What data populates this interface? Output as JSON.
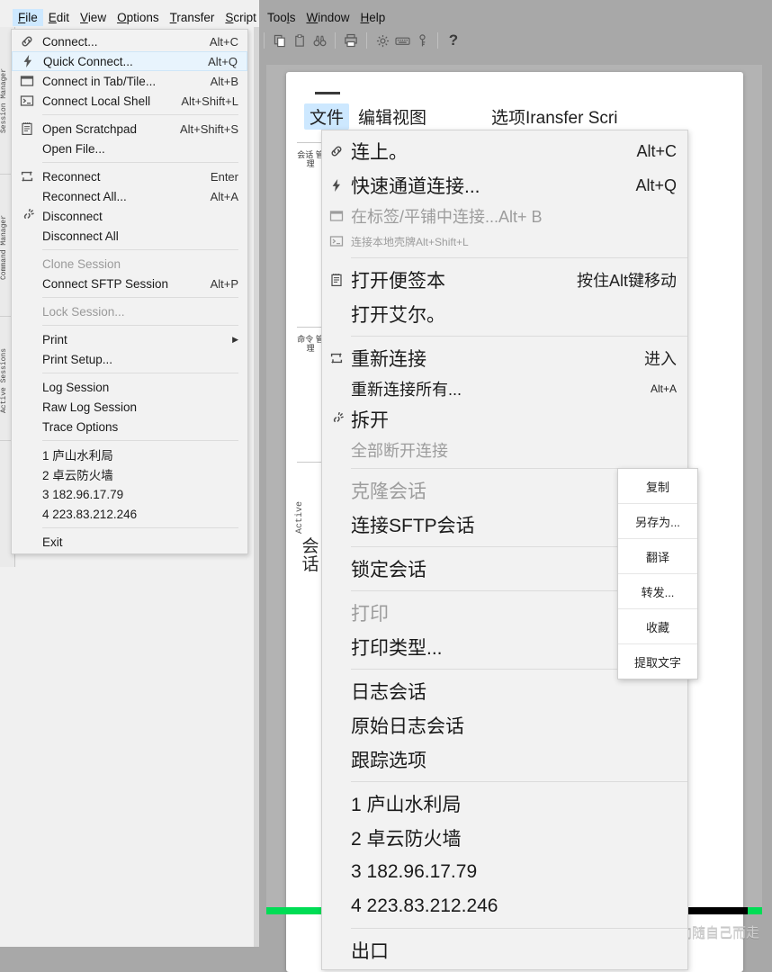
{
  "app": {
    "menubar": [
      {
        "label": "File",
        "mnemonic": "F",
        "active": true
      },
      {
        "label": "Edit",
        "mnemonic": "E",
        "active": false
      },
      {
        "label": "View",
        "mnemonic": "V",
        "active": false
      },
      {
        "label": "Options",
        "mnemonic": "O",
        "active": false
      },
      {
        "label": "Transfer",
        "mnemonic": "T",
        "active": false
      },
      {
        "label": "Script",
        "mnemonic": "S",
        "active": false
      },
      {
        "label": "Tools",
        "mnemonic": "l",
        "active": false
      },
      {
        "label": "Window",
        "mnemonic": "W",
        "active": false
      },
      {
        "label": "Help",
        "mnemonic": "H",
        "active": false
      }
    ],
    "toolbar_icons": [
      "copy-icon",
      "paste-icon",
      "find-icon",
      "print-icon",
      "settings-gear-icon",
      "keyboard-icon",
      "key-icon",
      "help-question-icon"
    ],
    "side_tabs": [
      {
        "label": "Session Manager"
      },
      {
        "label": "Command Manager"
      },
      {
        "label": "Active Sessions"
      }
    ]
  },
  "file_menu": {
    "items": [
      {
        "label": "Connect...",
        "accel": "Alt+C",
        "icon": "link-icon",
        "state": "normal",
        "type": "item"
      },
      {
        "label": "Quick Connect...",
        "accel": "Alt+Q",
        "icon": "lightning-icon",
        "state": "highlighted",
        "type": "item"
      },
      {
        "label": "Connect in Tab/Tile...",
        "accel": "Alt+B",
        "icon": "window-icon",
        "state": "normal",
        "type": "item"
      },
      {
        "label": "Connect Local Shell",
        "accel": "Alt+Shift+L",
        "icon": "terminal-icon",
        "state": "normal",
        "type": "item"
      },
      {
        "type": "separator"
      },
      {
        "label": "Open Scratchpad",
        "accel": "Alt+Shift+S",
        "icon": "notepad-icon",
        "state": "normal",
        "type": "item"
      },
      {
        "label": "Open File...",
        "accel": "",
        "icon": "",
        "state": "normal",
        "type": "item"
      },
      {
        "type": "separator"
      },
      {
        "label": "Reconnect",
        "accel": "Enter",
        "icon": "reconnect-icon",
        "state": "normal",
        "type": "item"
      },
      {
        "label": "Reconnect All...",
        "accel": "Alt+A",
        "icon": "",
        "state": "normal",
        "type": "item"
      },
      {
        "label": "Disconnect",
        "accel": "",
        "icon": "disconnect-icon",
        "state": "normal",
        "type": "item"
      },
      {
        "label": "Disconnect All",
        "accel": "",
        "icon": "",
        "state": "normal",
        "type": "item"
      },
      {
        "type": "separator"
      },
      {
        "label": "Clone Session",
        "accel": "",
        "icon": "",
        "state": "disabled",
        "type": "item"
      },
      {
        "label": "Connect SFTP Session",
        "accel": "Alt+P",
        "icon": "",
        "state": "normal",
        "type": "item"
      },
      {
        "type": "separator"
      },
      {
        "label": "Lock Session...",
        "accel": "",
        "icon": "",
        "state": "disabled",
        "type": "item"
      },
      {
        "type": "separator"
      },
      {
        "label": "Print",
        "accel": "",
        "icon": "",
        "state": "submenu",
        "type": "item"
      },
      {
        "label": "Print Setup...",
        "accel": "",
        "icon": "",
        "state": "normal",
        "type": "item"
      },
      {
        "type": "separator"
      },
      {
        "label": "Log Session",
        "accel": "",
        "icon": "",
        "state": "normal",
        "type": "item"
      },
      {
        "label": "Raw Log Session",
        "accel": "",
        "icon": "",
        "state": "normal",
        "type": "item"
      },
      {
        "label": "Trace Options",
        "accel": "",
        "icon": "",
        "state": "normal",
        "type": "item"
      },
      {
        "type": "separator"
      },
      {
        "label": "1 庐山水利局",
        "accel": "",
        "icon": "",
        "state": "normal",
        "type": "item"
      },
      {
        "label": "2 卓云防火墙",
        "accel": "",
        "icon": "",
        "state": "normal",
        "type": "item"
      },
      {
        "label": "3 182.96.17.79",
        "accel": "",
        "icon": "",
        "state": "normal",
        "type": "item"
      },
      {
        "label": "4 223.83.212.246",
        "accel": "",
        "icon": "",
        "state": "normal",
        "type": "item"
      },
      {
        "type": "separator"
      },
      {
        "label": "Exit",
        "accel": "",
        "icon": "",
        "state": "normal",
        "type": "item"
      }
    ]
  },
  "inner_screenshot": {
    "menubar": [
      {
        "label": "文件",
        "active": true
      },
      {
        "label": "编辑视图",
        "active": false
      },
      {
        "label": "选项Iransfer Scri",
        "active": false
      }
    ],
    "side_tabs": [
      {
        "label": "会话\n管理"
      },
      {
        "label": "命令\n管理"
      },
      {
        "label": "Active"
      },
      {
        "label": "会话"
      }
    ],
    "menu_items": [
      {
        "label": "连上。",
        "accel": "Alt+C",
        "icon": "link-icon",
        "size": "lg",
        "state": "normal",
        "type": "item"
      },
      {
        "label": "快速通道连接...",
        "accel": "Alt+Q",
        "icon": "lightning-icon",
        "size": "lg",
        "state": "normal",
        "type": "item"
      },
      {
        "label": "在标签/平铺中连接...Alt+ B",
        "accel": "",
        "icon": "window-icon",
        "size": "md",
        "state": "dim",
        "type": "item"
      },
      {
        "label": "连接本地壳牌Alt+Shift+L",
        "accel": "",
        "icon": "terminal-icon",
        "size": "sm",
        "state": "dim",
        "type": "item"
      },
      {
        "type": "separator"
      },
      {
        "label": "打开便签本",
        "accel": "按住Alt键移动",
        "icon": "notepad-icon",
        "size": "lg",
        "state": "normal",
        "type": "item"
      },
      {
        "label": "打开艾尔。",
        "accel": "",
        "icon": "",
        "size": "lg",
        "state": "normal",
        "type": "item"
      },
      {
        "type": "separator"
      },
      {
        "label": "重新连接",
        "accel": "进入",
        "icon": "reconnect-icon",
        "size": "lg",
        "state": "normal",
        "type": "item"
      },
      {
        "label": "重新连接所有...",
        "accel": "Alt+A",
        "icon": "",
        "size": "md",
        "state": "normal",
        "type": "item"
      },
      {
        "label": "拆开",
        "accel": "",
        "icon": "disconnect-icon",
        "size": "lg",
        "state": "normal",
        "type": "item"
      },
      {
        "label": "全部断开连接",
        "accel": "",
        "icon": "",
        "size": "md",
        "state": "dim",
        "type": "item"
      },
      {
        "type": "separator"
      },
      {
        "label": "克隆会话",
        "accel": "",
        "icon": "",
        "size": "lg",
        "state": "dim",
        "type": "item"
      },
      {
        "label": "连接SFTP会话",
        "accel": "",
        "icon": "",
        "size": "lg",
        "state": "normal",
        "type": "item"
      },
      {
        "type": "separator"
      },
      {
        "label": "锁定会话",
        "accel": "",
        "icon": "",
        "size": "lg",
        "state": "normal",
        "type": "item"
      },
      {
        "type": "separator"
      },
      {
        "label": "打印",
        "accel": "",
        "icon": "",
        "size": "lg",
        "state": "dim",
        "type": "item"
      },
      {
        "label": "打印类型...",
        "accel": "",
        "icon": "",
        "size": "lg",
        "state": "normal",
        "type": "item"
      },
      {
        "type": "separator"
      },
      {
        "label": "日志会话",
        "accel": "",
        "icon": "",
        "size": "lg",
        "state": "normal",
        "type": "item"
      },
      {
        "label": "原始日志会话",
        "accel": "",
        "icon": "",
        "size": "lg",
        "state": "normal",
        "type": "item"
      },
      {
        "label": "跟踪选项",
        "accel": "",
        "icon": "",
        "size": "lg",
        "state": "normal",
        "type": "item"
      },
      {
        "type": "separator"
      },
      {
        "label": "1 庐山水利局",
        "accel": "",
        "icon": "",
        "size": "lg",
        "state": "normal",
        "type": "item"
      },
      {
        "label": "2 卓云防火墙",
        "accel": "",
        "icon": "",
        "size": "lg",
        "state": "normal",
        "type": "item"
      },
      {
        "label": "3 182.96.17.79",
        "accel": "",
        "icon": "",
        "size": "lg",
        "state": "normal",
        "type": "item"
      },
      {
        "label": "4 223.83.212.246",
        "accel": "",
        "icon": "",
        "size": "lg",
        "state": "normal",
        "type": "item"
      },
      {
        "type": "separator"
      },
      {
        "label": "出口",
        "accel": "",
        "icon": "",
        "size": "lg",
        "state": "normal",
        "type": "item"
      }
    ],
    "context_menu": [
      {
        "label": "复制"
      },
      {
        "label": "另存为..."
      },
      {
        "label": "翻译"
      },
      {
        "label": "转发..."
      },
      {
        "label": "收藏"
      },
      {
        "label": "提取文字"
      }
    ]
  },
  "watermark": {
    "text": "CSDN @人生的方向随自己而走"
  },
  "colors": {
    "highlight": "#e8f4fd",
    "menu_bg": "#f2f2f2",
    "desktop": "#a8a8a8",
    "progress_green": "#00dd55",
    "progress_black": "#000000",
    "accent_tab": "#cde8ff"
  }
}
